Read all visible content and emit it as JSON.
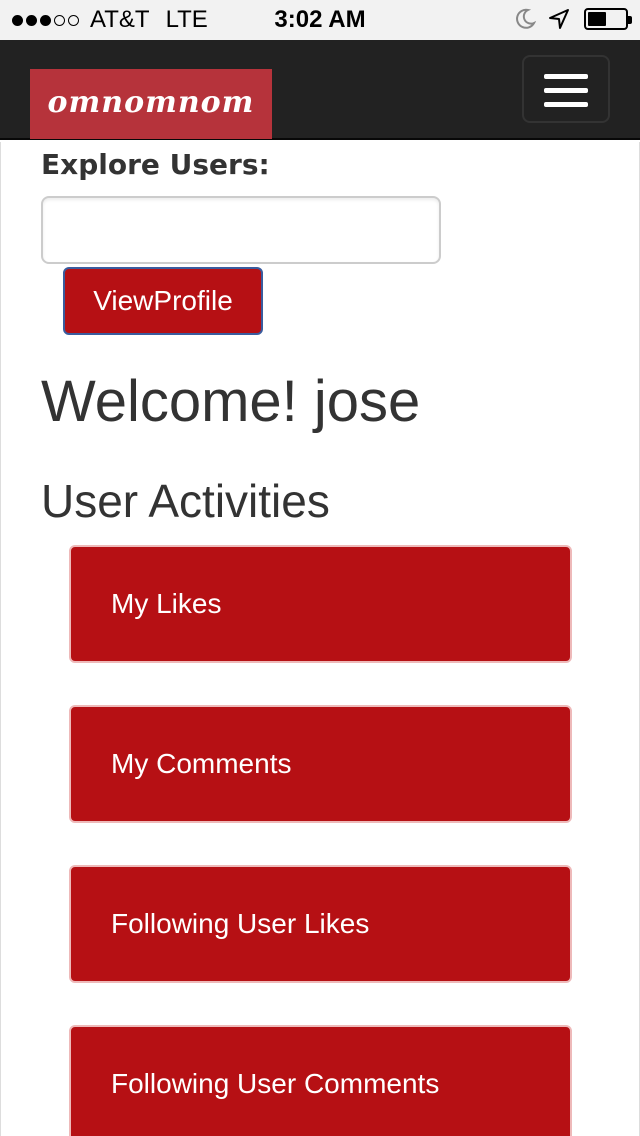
{
  "status_bar": {
    "signal_dots": [
      true,
      true,
      true,
      false,
      false
    ],
    "carrier": "AT&T",
    "network": "LTE",
    "time": "3:02 AM",
    "icons": [
      "moon-icon",
      "location-arrow-icon",
      "battery-icon"
    ],
    "battery_level": 0.5
  },
  "navbar": {
    "brand": "omnomnom",
    "menu_icon": "hamburger-menu-icon",
    "brand_color": "#b6333b",
    "background": "#222222"
  },
  "explore": {
    "label": "Explore Users:",
    "input_value": "",
    "button_label": "ViewProfile"
  },
  "welcome": {
    "text": "Welcome! jose"
  },
  "activities": {
    "title": "User Activities",
    "items": [
      {
        "label": "My Likes"
      },
      {
        "label": "My Comments"
      },
      {
        "label": "Following User Likes"
      },
      {
        "label": "Following User Comments"
      }
    ]
  },
  "colors": {
    "accent": "#b61014",
    "text": "#333333"
  }
}
